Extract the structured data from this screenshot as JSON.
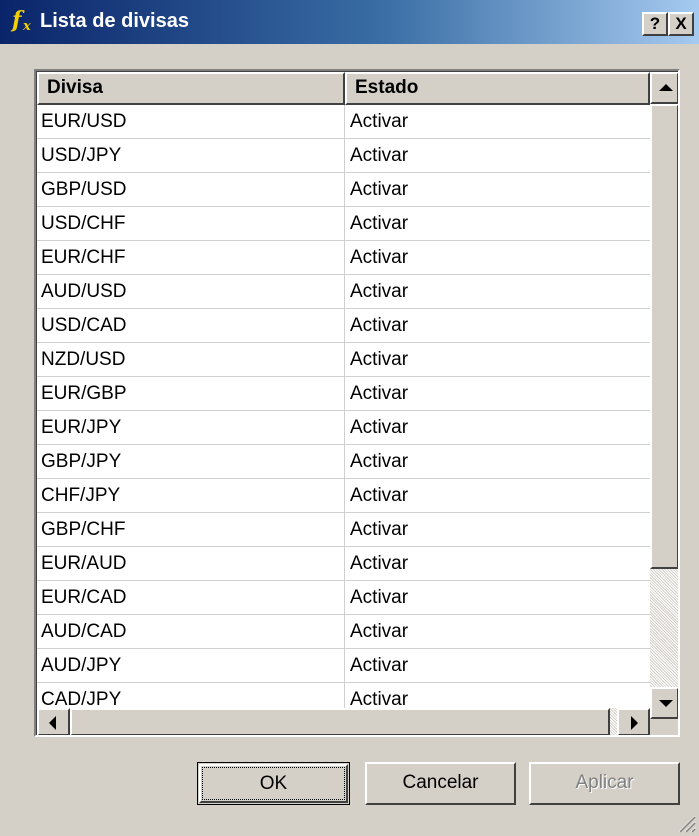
{
  "window": {
    "title": "Lista de divisas",
    "icon": "fx-app-icon",
    "help_label": "?",
    "close_label": "X"
  },
  "table": {
    "columns": [
      "Divisa",
      "Estado"
    ],
    "rows": [
      {
        "divisa": "EUR/USD",
        "estado": "Activar"
      },
      {
        "divisa": "USD/JPY",
        "estado": "Activar"
      },
      {
        "divisa": "GBP/USD",
        "estado": "Activar"
      },
      {
        "divisa": "USD/CHF",
        "estado": "Activar"
      },
      {
        "divisa": "EUR/CHF",
        "estado": "Activar"
      },
      {
        "divisa": "AUD/USD",
        "estado": "Activar"
      },
      {
        "divisa": "USD/CAD",
        "estado": "Activar"
      },
      {
        "divisa": "NZD/USD",
        "estado": "Activar"
      },
      {
        "divisa": "EUR/GBP",
        "estado": "Activar"
      },
      {
        "divisa": "EUR/JPY",
        "estado": "Activar"
      },
      {
        "divisa": "GBP/JPY",
        "estado": "Activar"
      },
      {
        "divisa": "CHF/JPY",
        "estado": "Activar"
      },
      {
        "divisa": "GBP/CHF",
        "estado": "Activar"
      },
      {
        "divisa": "EUR/AUD",
        "estado": "Activar"
      },
      {
        "divisa": "EUR/CAD",
        "estado": "Activar"
      },
      {
        "divisa": "AUD/CAD",
        "estado": "Activar"
      },
      {
        "divisa": "AUD/JPY",
        "estado": "Activar"
      },
      {
        "divisa": "CAD/JPY",
        "estado": "Activar"
      }
    ]
  },
  "buttons": {
    "ok": "OK",
    "cancel": "Cancelar",
    "apply": "Aplicar"
  },
  "colors": {
    "titlebar_start": "#0a246a",
    "titlebar_end": "#a6caf0",
    "face": "#d4d0c8",
    "disabled_text": "#808080"
  }
}
